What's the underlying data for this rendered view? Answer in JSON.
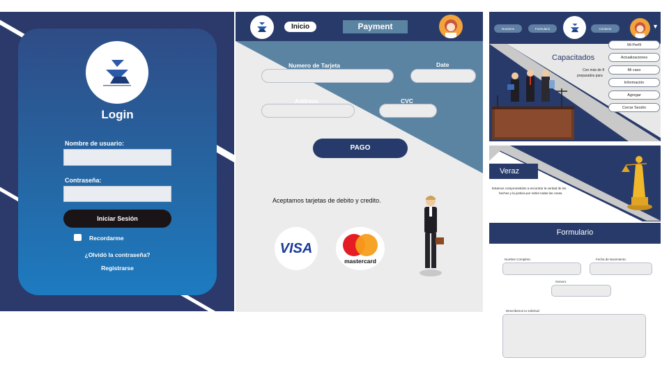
{
  "login": {
    "title": "Login",
    "username_label": "Nombre de usuario:",
    "password_label": "Contraseña:",
    "submit": "Iniciar Sesión",
    "remember": "Recordarme",
    "forgot": "¿Olvidó la contraseña?",
    "register": "Registrarse"
  },
  "payment": {
    "nav_home": "Inicio",
    "title": "Payment",
    "card_number_label": "Numero de Tarjeta",
    "date_label": "Date",
    "address_label": "Address",
    "cvc_label": "CVC",
    "pay_button": "PAGO",
    "accepted_text": "Aceptamos tarjetas de debito y credito.",
    "visa": "VISA",
    "mastercard": "mastercard"
  },
  "home": {
    "nav": [
      "Nosotros",
      "Formulario",
      "Contacto"
    ],
    "menu": [
      "Mi Perfil",
      "Actualizaciones",
      "Mi caso",
      "Información",
      "Agregar",
      "Cerrar Sesión"
    ],
    "hero_title": "Capacitados",
    "hero_text_1": "Con más de 8",
    "hero_text_2": "preparados para"
  },
  "veraz": {
    "title": "Veraz",
    "text_1": "Estamos comprometidos a encontrar la verdad de los",
    "text_2": "hechos y la justicia por sobre todas las cosas."
  },
  "form": {
    "title": "Formulario",
    "full_name": "Nombre Completo:",
    "birth_date": "Fecha de Nacimiento:",
    "gender": "Genero:",
    "request": "Describenos tu solicitud:"
  },
  "colors": {
    "navy": "#283a6a",
    "steel": "#5b84a3",
    "button": "#263a6b"
  }
}
